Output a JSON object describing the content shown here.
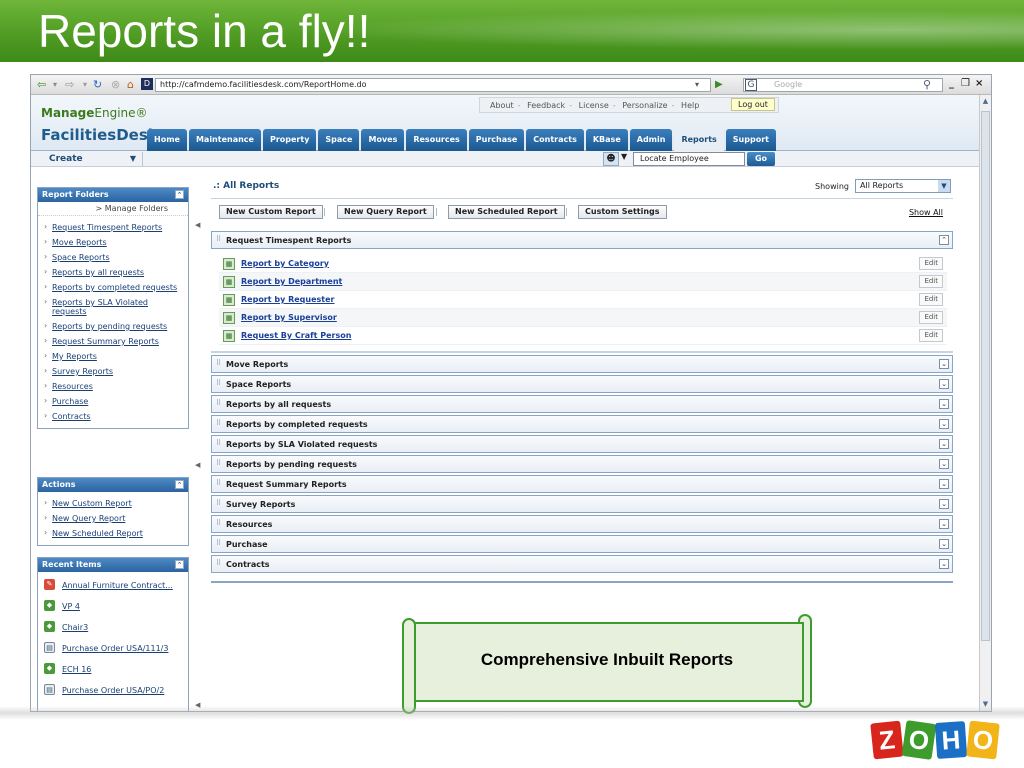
{
  "slide": {
    "title": "Reports in a fly!!",
    "callout": "Comprehensive Inbuilt Reports",
    "logo_letters": [
      "Z",
      "O",
      "H",
      "O"
    ],
    "logo_colors": [
      "#d9261c",
      "#3d9c2c",
      "#1b6fc4",
      "#f3b41a"
    ]
  },
  "browser": {
    "url": "http://cafmdemo.facilitiesdesk.com/ReportHome.do",
    "search_placeholder": "Google",
    "window_controls": [
      "_",
      "❐",
      "×"
    ]
  },
  "header": {
    "logo_line1_bold": "Manage",
    "logo_line1_rest": "Engine®",
    "logo_line2": "FacilitiesDesk",
    "top_links": [
      "About",
      "Feedback",
      "License",
      "Personalize",
      "Help"
    ],
    "logout": "Log out",
    "tabs": [
      "Home",
      "Maintenance",
      "Property",
      "Space",
      "Moves",
      "Resources",
      "Purchase",
      "Contracts",
      "KBase",
      "Admin",
      "Reports",
      "Support"
    ],
    "active_tab": "Reports"
  },
  "subbar": {
    "create": "Create",
    "employee_placeholder": "Locate Employee",
    "go": "Go"
  },
  "left": {
    "folders_title": "Report Folders",
    "manage_folders": "> Manage Folders",
    "folders": [
      "Request Timespent Reports",
      "Move Reports",
      "Space Reports",
      "Reports by all requests",
      "Reports by completed requests",
      "Reports by SLA Violated requests",
      "Reports by pending requests",
      "Request Summary Reports",
      "My Reports",
      "Survey Reports",
      "Resources",
      "Purchase",
      "Contracts"
    ],
    "actions_title": "Actions",
    "actions": [
      "New Custom Report",
      "New Query Report",
      "New Scheduled Report"
    ],
    "recent_title": "Recent Items",
    "recent": [
      "Annual Furniture Contract...",
      "VP 4",
      "Chair3",
      "Purchase Order USA/111/3",
      "ECH 16",
      "Purchase Order USA/PO/2"
    ]
  },
  "main": {
    "title": ".: All Reports",
    "showing_label": "Showing",
    "showing_value": "All Reports",
    "buttons": [
      "New Custom Report",
      "New Query Report",
      "New Scheduled Report",
      "Custom Settings"
    ],
    "show_all": "Show All",
    "expanded_category": "Request Timespent Reports",
    "expanded_reports": [
      "Report by Category",
      "Report by Department",
      "Report by Requester",
      "Report by Supervisor",
      "Request By Craft Person"
    ],
    "edit_label": "Edit",
    "categories": [
      "Move Reports",
      "Space Reports",
      "Reports by all requests",
      "Reports by completed requests",
      "Reports by SLA Violated requests",
      "Reports by pending requests",
      "Request Summary Reports",
      "Survey Reports",
      "Resources",
      "Purchase",
      "Contracts"
    ]
  }
}
